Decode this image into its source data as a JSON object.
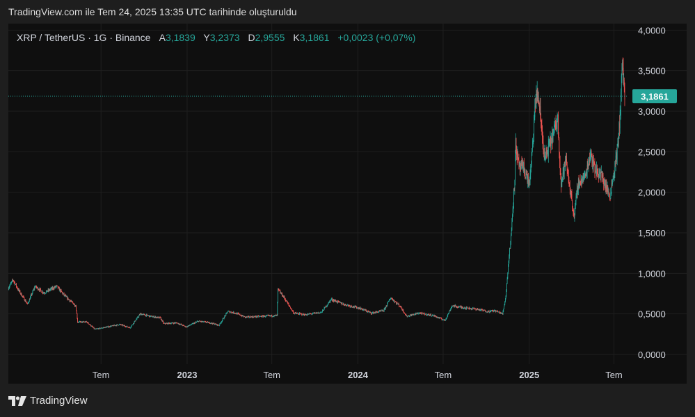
{
  "caption": "TradingView.com ile Tem 24, 2025 13:35 UTC tarihinde oluşturuldu",
  "footer_brand": "TradingView",
  "colors": {
    "up": "#26a69a",
    "down": "#ef5350",
    "bg": "#0f0f0f",
    "grid": "#1f1f1f",
    "text": "#d1d4dc",
    "price_tag": "#26a69a"
  },
  "chart_data": {
    "type": "candlestick",
    "symbol_line": {
      "symbol": "XRP / TetherUS · 1G · Binance",
      "open_label": "A",
      "open": "3,1839",
      "high_label": "Y",
      "high": "3,2373",
      "low_label": "D",
      "low": "2,9555",
      "close_label": "K",
      "close": "3,1861",
      "change": "+0,0023 (+0,07%)"
    },
    "last_price": 3.1861,
    "last_price_label": "3,1861",
    "y_ticks": [
      {
        "v": 4.0,
        "label": "4,0000"
      },
      {
        "v": 3.5,
        "label": "3,5000"
      },
      {
        "v": 3.0,
        "label": "3,0000"
      },
      {
        "v": 2.5,
        "label": "2,5000"
      },
      {
        "v": 2.0,
        "label": "2,0000"
      },
      {
        "v": 1.5,
        "label": "1,5000"
      },
      {
        "v": 1.0,
        "label": "1,0000"
      },
      {
        "v": 0.5,
        "label": "0,5000"
      },
      {
        "v": 0.0,
        "label": "0,0000"
      }
    ],
    "x_ticks": [
      {
        "date": "2022-07-01",
        "label": "Tem",
        "bold": false
      },
      {
        "date": "2023-01-01",
        "label": "2023",
        "bold": true
      },
      {
        "date": "2023-07-01",
        "label": "Tem",
        "bold": false
      },
      {
        "date": "2024-01-01",
        "label": "2024",
        "bold": true
      },
      {
        "date": "2024-07-01",
        "label": "Tem",
        "bold": false
      },
      {
        "date": "2025-01-01",
        "label": "2025",
        "bold": true
      },
      {
        "date": "2025-07-01",
        "label": "Tem",
        "bold": false
      }
    ],
    "x_range": [
      "2021-12-15",
      "2025-07-30"
    ],
    "y_range": [
      -0.12,
      4.08
    ],
    "price_path": [
      [
        "2021-12-15",
        0.82
      ],
      [
        "2021-12-25",
        0.92
      ],
      [
        "2022-01-05",
        0.8
      ],
      [
        "2022-01-25",
        0.62
      ],
      [
        "2022-02-10",
        0.84
      ],
      [
        "2022-03-01",
        0.76
      ],
      [
        "2022-03-28",
        0.84
      ],
      [
        "2022-04-15",
        0.72
      ],
      [
        "2022-05-08",
        0.6
      ],
      [
        "2022-05-12",
        0.4
      ],
      [
        "2022-06-01",
        0.4
      ],
      [
        "2022-06-18",
        0.31
      ],
      [
        "2022-07-15",
        0.34
      ],
      [
        "2022-08-10",
        0.37
      ],
      [
        "2022-09-01",
        0.33
      ],
      [
        "2022-09-23",
        0.5
      ],
      [
        "2022-10-15",
        0.47
      ],
      [
        "2022-11-05",
        0.45
      ],
      [
        "2022-11-12",
        0.38
      ],
      [
        "2022-12-10",
        0.39
      ],
      [
        "2022-12-30",
        0.34
      ],
      [
        "2023-01-25",
        0.41
      ],
      [
        "2023-02-20",
        0.39
      ],
      [
        "2023-03-10",
        0.36
      ],
      [
        "2023-03-29",
        0.53
      ],
      [
        "2023-04-15",
        0.51
      ],
      [
        "2023-05-05",
        0.46
      ],
      [
        "2023-06-10",
        0.47
      ],
      [
        "2023-07-12",
        0.48
      ],
      [
        "2023-07-14",
        0.8
      ],
      [
        "2023-07-25",
        0.72
      ],
      [
        "2023-08-17",
        0.51
      ],
      [
        "2023-09-10",
        0.49
      ],
      [
        "2023-10-15",
        0.52
      ],
      [
        "2023-11-05",
        0.68
      ],
      [
        "2023-12-01",
        0.62
      ],
      [
        "2024-01-05",
        0.57
      ],
      [
        "2024-01-30",
        0.51
      ],
      [
        "2024-02-25",
        0.54
      ],
      [
        "2024-03-11",
        0.7
      ],
      [
        "2024-04-01",
        0.59
      ],
      [
        "2024-04-14",
        0.47
      ],
      [
        "2024-05-10",
        0.51
      ],
      [
        "2024-06-10",
        0.48
      ],
      [
        "2024-07-05",
        0.42
      ],
      [
        "2024-07-20",
        0.6
      ],
      [
        "2024-08-10",
        0.58
      ],
      [
        "2024-09-10",
        0.56
      ],
      [
        "2024-10-05",
        0.53
      ],
      [
        "2024-10-20",
        0.54
      ],
      [
        "2024-11-05",
        0.5
      ],
      [
        "2024-11-12",
        0.72
      ],
      [
        "2024-11-17",
        1.1
      ],
      [
        "2024-11-23",
        1.45
      ],
      [
        "2024-12-01",
        2.2
      ],
      [
        "2024-12-03",
        2.6
      ],
      [
        "2024-12-10",
        2.3
      ],
      [
        "2024-12-20",
        2.3
      ],
      [
        "2025-01-01",
        2.1
      ],
      [
        "2025-01-06",
        2.4
      ],
      [
        "2025-01-16",
        3.25
      ],
      [
        "2025-01-22",
        3.1
      ],
      [
        "2025-02-03",
        2.4
      ],
      [
        "2025-02-20",
        2.7
      ],
      [
        "2025-03-03",
        2.9
      ],
      [
        "2025-03-10",
        2.1
      ],
      [
        "2025-03-20",
        2.4
      ],
      [
        "2025-04-07",
        1.7
      ],
      [
        "2025-04-15",
        2.1
      ],
      [
        "2025-05-01",
        2.2
      ],
      [
        "2025-05-12",
        2.5
      ],
      [
        "2025-05-20",
        2.3
      ],
      [
        "2025-06-05",
        2.2
      ],
      [
        "2025-06-22",
        1.95
      ],
      [
        "2025-07-01",
        2.25
      ],
      [
        "2025-07-10",
        2.6
      ],
      [
        "2025-07-14",
        2.95
      ],
      [
        "2025-07-18",
        3.55
      ],
      [
        "2025-07-21",
        3.45
      ],
      [
        "2025-07-24",
        3.18
      ]
    ]
  }
}
